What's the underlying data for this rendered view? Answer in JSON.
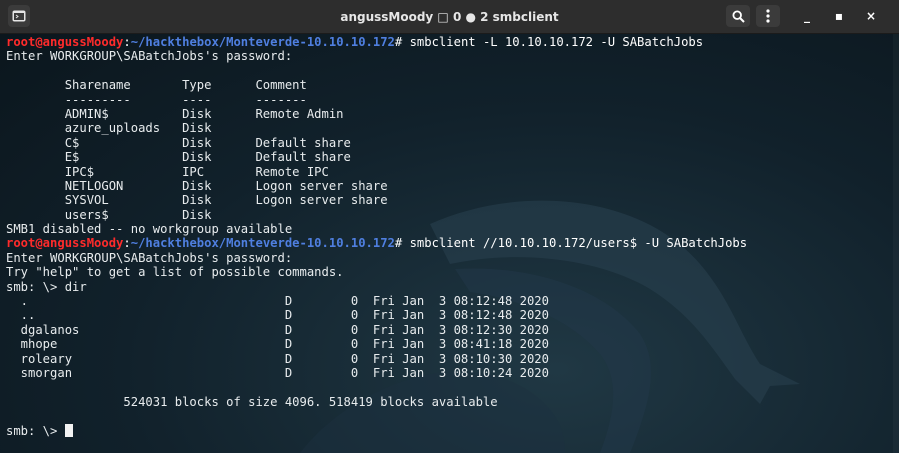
{
  "window": {
    "title": "angussMoody □ 0 ● 2 smbclient"
  },
  "titlebar": {
    "new_tab_icon": "terminal-tab-icon",
    "search_icon": "magnifier-icon",
    "menu_icon": "kebab-menu-icon",
    "minimize_label": "_",
    "maximize_label": "▪",
    "close_label": "×"
  },
  "colors": {
    "prompt_user": "#ff2b2b",
    "prompt_path": "#4f7fe0",
    "text": "#e8ecee",
    "background": "#11212b"
  },
  "terminal": {
    "prompt": {
      "user_host": "root@angussMoody",
      "separator": ":",
      "path": "~/hackthebox/Monteverde-10.10.10.172",
      "symbol": "#"
    },
    "commands": [
      " smbclient -L 10.10.10.172 -U SABatchJobs",
      " smbclient //10.10.10.172/users$ -U SABatchJobs"
    ],
    "output_block_1": [
      "Enter WORKGROUP\\SABatchJobs's password:",
      "",
      "        Sharename       Type      Comment",
      "        ---------       ----      -------",
      "        ADMIN$          Disk      Remote Admin",
      "        azure_uploads   Disk",
      "        C$              Disk      Default share",
      "        E$              Disk      Default share",
      "        IPC$            IPC       Remote IPC",
      "        NETLOGON        Disk      Logon server share",
      "        SYSVOL          Disk      Logon server share",
      "        users$          Disk",
      "SMB1 disabled -- no workgroup available"
    ],
    "output_block_2": [
      "Enter WORKGROUP\\SABatchJobs's password:",
      "Try \"help\" to get a list of possible commands.",
      "smb: \\> dir",
      "  .                                   D        0  Fri Jan  3 08:12:48 2020",
      "  ..                                  D        0  Fri Jan  3 08:12:48 2020",
      "  dgalanos                            D        0  Fri Jan  3 08:12:30 2020",
      "  mhope                               D        0  Fri Jan  3 08:41:18 2020",
      "  roleary                             D        0  Fri Jan  3 08:10:30 2020",
      "  smorgan                             D        0  Fri Jan  3 08:10:24 2020",
      "",
      "                524031 blocks of size 4096. 518419 blocks available",
      ""
    ],
    "final_prompt": "smb: \\> "
  }
}
